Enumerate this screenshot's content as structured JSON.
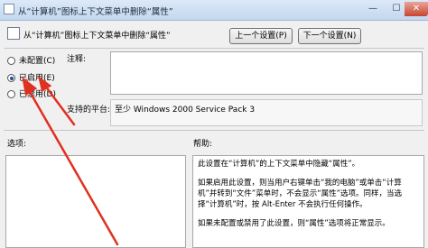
{
  "window": {
    "title": "从“计算机”图标上下文菜单中删除“属性”",
    "minimize": "—",
    "maximize": "☐",
    "close": "✕"
  },
  "header": {
    "title": "从“计算机”图标上下文菜单中删除“属性”",
    "prev_button": "上一个设置(P)",
    "next_button": "下一个设置(N)"
  },
  "options": {
    "not_configured": "未配置(C)",
    "enabled": "已启用(E)",
    "disabled": "已禁用(D)",
    "selected": "enabled"
  },
  "comment": {
    "label": "注释:",
    "value": ""
  },
  "supported": {
    "label": "支持的平台:",
    "value": "至少 Windows 2000 Service Pack 3"
  },
  "sections": {
    "options_label": "选项:",
    "help_label": "帮助:"
  },
  "help": {
    "p1": "此设置在“计算机”的上下文菜单中隐藏“属性”。",
    "p2": "如果启用此设置，则当用户右键单击“我的电脑”或单击“计算机”并转到“文件”菜单时，不会显示“属性”选项。同样，当选择“计算机”时，按 Alt-Enter 不会执行任何操作。",
    "p3": "如果未配置或禁用了此设置，则“属性”选项将正常显示。"
  },
  "annotation": {
    "arrow_color": "#e03020"
  }
}
